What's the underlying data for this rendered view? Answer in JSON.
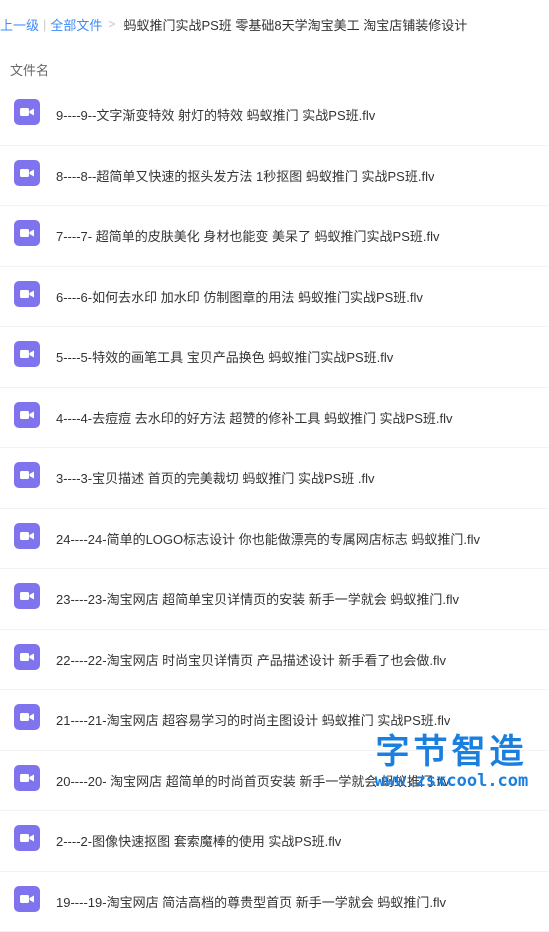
{
  "breadcrumb": {
    "back": "上一级",
    "all_files": "全部文件",
    "current": "蚂蚁推门实战PS班 零基础8天学淘宝美工 淘宝店铺装修设计"
  },
  "list": {
    "column_header": "文件名",
    "files": [
      {
        "name": "9----9--文字渐变特效 射灯的特效 蚂蚁推门 实战PS班.flv"
      },
      {
        "name": "8----8--超简单又快速的抠头发方法 1秒抠图 蚂蚁推门 实战PS班.flv"
      },
      {
        "name": "7----7- 超简单的皮肤美化 身材也能变 美呆了 蚂蚁推门实战PS班.flv"
      },
      {
        "name": "6----6-如何去水印 加水印 仿制图章的用法 蚂蚁推门实战PS班.flv"
      },
      {
        "name": "5----5-特效的画笔工具 宝贝产品换色 蚂蚁推门实战PS班.flv"
      },
      {
        "name": "4----4-去痘痘 去水印的好方法 超赞的修补工具 蚂蚁推门 实战PS班.flv"
      },
      {
        "name": "3----3-宝贝描述 首页的完美裁切 蚂蚁推门 实战PS班 .flv"
      },
      {
        "name": "24----24-简单的LOGO标志设计 你也能做漂亮的专属网店标志 蚂蚁推门.flv"
      },
      {
        "name": "23----23-淘宝网店 超简单宝贝详情页的安装 新手一学就会 蚂蚁推门.flv"
      },
      {
        "name": "22----22-淘宝网店 时尚宝贝详情页 产品描述设计 新手看了也会做.flv"
      },
      {
        "name": "21----21-淘宝网店 超容易学习的时尚主图设计 蚂蚁推门 实战PS班.flv"
      },
      {
        "name": "20----20- 淘宝网店 超简单的时尚首页安装 新手一学就会 蚂蚁推门.flv"
      },
      {
        "name": "2----2-图像快速抠图 套索魔棒的使用 实战PS班.flv"
      },
      {
        "name": "19----19-淘宝网店 简洁高档的尊贵型首页 新手一学就会 蚂蚁推门.flv"
      }
    ]
  },
  "watermark": {
    "title": "字节智造",
    "url": "www.zsxcool.com"
  },
  "colors": {
    "link": "#3b8cff",
    "video_icon": "#7f73ee",
    "watermark": "#1b7fe0"
  }
}
